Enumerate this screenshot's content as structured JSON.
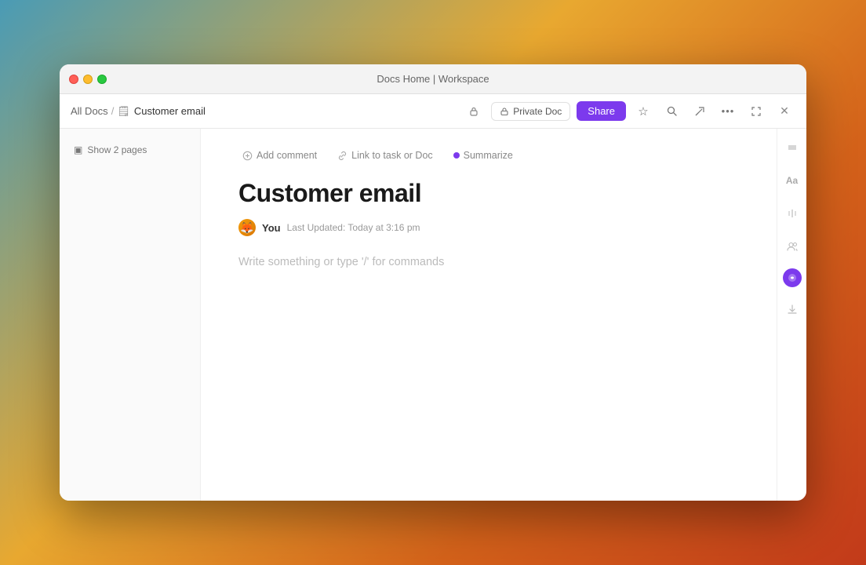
{
  "titlebar": {
    "title": "Docs Home | Workspace"
  },
  "breadcrumb": {
    "parent_label": "All Docs",
    "separator": "/",
    "current_label": "Customer email",
    "doc_icon": "📄"
  },
  "toolbar": {
    "private_doc_label": "Private Doc",
    "share_label": "Share",
    "star_icon": "☆",
    "search_icon": "⌕",
    "export_icon": "↗",
    "more_icon": "•••",
    "minimize_icon": "⤢",
    "close_icon": "✕"
  },
  "sidebar": {
    "show_pages_label": "Show 2 pages",
    "pages_icon": "▣"
  },
  "doc_toolbar": {
    "add_comment_label": "Add comment",
    "link_task_label": "Link to task or Doc",
    "summarize_label": "Summarize"
  },
  "document": {
    "title": "Customer email",
    "author": "You",
    "last_updated": "Last Updated: Today at 3:16 pm",
    "placeholder": "Write something or type '/' for commands"
  },
  "right_sidebar": {
    "text_format_icon": "Aa",
    "collapse_icon": "↕",
    "users_icon": "👤",
    "download_icon": "↓"
  },
  "colors": {
    "share_btn_bg": "#7c3aed",
    "ai_indicator_bg": "#7c3aed"
  }
}
